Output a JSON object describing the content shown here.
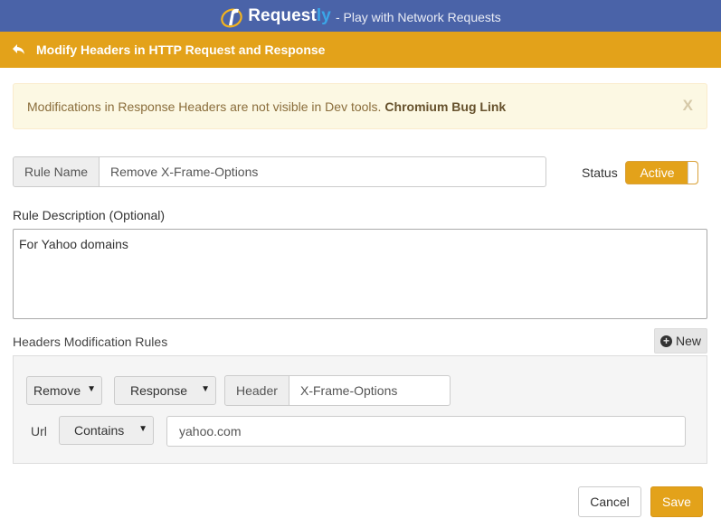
{
  "app": {
    "brand_main": "Request",
    "brand_accent": "ly",
    "tagline": "- Play with Network Requests",
    "brand_color": "#4a63a8",
    "accent_color": "#e3a21a"
  },
  "titlebar": {
    "back_icon": "back-arrow-icon",
    "title": "Modify Headers in HTTP Request and Response"
  },
  "alert": {
    "message": "Modifications in Response Headers are not visible in Dev tools.",
    "link_text": "Chromium Bug Link",
    "close_label": "X"
  },
  "rule": {
    "name_label": "Rule Name",
    "name_value": "Remove X-Frame-Options",
    "status_label": "Status",
    "status_value": "Active",
    "description_label": "Rule Description (Optional)",
    "description_value": "For Yahoo domains"
  },
  "modifications": {
    "section_label": "Headers Modification Rules",
    "new_button": "New",
    "pairs": [
      {
        "operation": "Remove",
        "target": "Response",
        "header_label": "Header",
        "header_value": "X-Frame-Options",
        "url_label": "Url",
        "url_operator": "Contains",
        "url_value": "yahoo.com"
      }
    ]
  },
  "footer": {
    "cancel": "Cancel",
    "save": "Save"
  }
}
